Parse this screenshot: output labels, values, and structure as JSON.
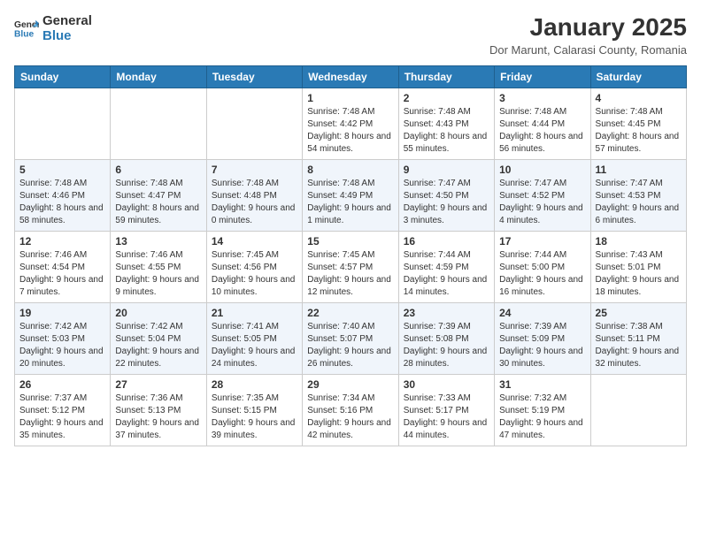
{
  "logo": {
    "general": "General",
    "blue": "Blue"
  },
  "header": {
    "title": "January 2025",
    "subtitle": "Dor Marunt, Calarasi County, Romania"
  },
  "weekdays": [
    "Sunday",
    "Monday",
    "Tuesday",
    "Wednesday",
    "Thursday",
    "Friday",
    "Saturday"
  ],
  "weeks": [
    [
      {
        "day": "",
        "sunrise": "",
        "sunset": "",
        "daylight": ""
      },
      {
        "day": "",
        "sunrise": "",
        "sunset": "",
        "daylight": ""
      },
      {
        "day": "",
        "sunrise": "",
        "sunset": "",
        "daylight": ""
      },
      {
        "day": "1",
        "sunrise": "Sunrise: 7:48 AM",
        "sunset": "Sunset: 4:42 PM",
        "daylight": "Daylight: 8 hours and 54 minutes."
      },
      {
        "day": "2",
        "sunrise": "Sunrise: 7:48 AM",
        "sunset": "Sunset: 4:43 PM",
        "daylight": "Daylight: 8 hours and 55 minutes."
      },
      {
        "day": "3",
        "sunrise": "Sunrise: 7:48 AM",
        "sunset": "Sunset: 4:44 PM",
        "daylight": "Daylight: 8 hours and 56 minutes."
      },
      {
        "day": "4",
        "sunrise": "Sunrise: 7:48 AM",
        "sunset": "Sunset: 4:45 PM",
        "daylight": "Daylight: 8 hours and 57 minutes."
      }
    ],
    [
      {
        "day": "5",
        "sunrise": "Sunrise: 7:48 AM",
        "sunset": "Sunset: 4:46 PM",
        "daylight": "Daylight: 8 hours and 58 minutes."
      },
      {
        "day": "6",
        "sunrise": "Sunrise: 7:48 AM",
        "sunset": "Sunset: 4:47 PM",
        "daylight": "Daylight: 8 hours and 59 minutes."
      },
      {
        "day": "7",
        "sunrise": "Sunrise: 7:48 AM",
        "sunset": "Sunset: 4:48 PM",
        "daylight": "Daylight: 9 hours and 0 minutes."
      },
      {
        "day": "8",
        "sunrise": "Sunrise: 7:48 AM",
        "sunset": "Sunset: 4:49 PM",
        "daylight": "Daylight: 9 hours and 1 minute."
      },
      {
        "day": "9",
        "sunrise": "Sunrise: 7:47 AM",
        "sunset": "Sunset: 4:50 PM",
        "daylight": "Daylight: 9 hours and 3 minutes."
      },
      {
        "day": "10",
        "sunrise": "Sunrise: 7:47 AM",
        "sunset": "Sunset: 4:52 PM",
        "daylight": "Daylight: 9 hours and 4 minutes."
      },
      {
        "day": "11",
        "sunrise": "Sunrise: 7:47 AM",
        "sunset": "Sunset: 4:53 PM",
        "daylight": "Daylight: 9 hours and 6 minutes."
      }
    ],
    [
      {
        "day": "12",
        "sunrise": "Sunrise: 7:46 AM",
        "sunset": "Sunset: 4:54 PM",
        "daylight": "Daylight: 9 hours and 7 minutes."
      },
      {
        "day": "13",
        "sunrise": "Sunrise: 7:46 AM",
        "sunset": "Sunset: 4:55 PM",
        "daylight": "Daylight: 9 hours and 9 minutes."
      },
      {
        "day": "14",
        "sunrise": "Sunrise: 7:45 AM",
        "sunset": "Sunset: 4:56 PM",
        "daylight": "Daylight: 9 hours and 10 minutes."
      },
      {
        "day": "15",
        "sunrise": "Sunrise: 7:45 AM",
        "sunset": "Sunset: 4:57 PM",
        "daylight": "Daylight: 9 hours and 12 minutes."
      },
      {
        "day": "16",
        "sunrise": "Sunrise: 7:44 AM",
        "sunset": "Sunset: 4:59 PM",
        "daylight": "Daylight: 9 hours and 14 minutes."
      },
      {
        "day": "17",
        "sunrise": "Sunrise: 7:44 AM",
        "sunset": "Sunset: 5:00 PM",
        "daylight": "Daylight: 9 hours and 16 minutes."
      },
      {
        "day": "18",
        "sunrise": "Sunrise: 7:43 AM",
        "sunset": "Sunset: 5:01 PM",
        "daylight": "Daylight: 9 hours and 18 minutes."
      }
    ],
    [
      {
        "day": "19",
        "sunrise": "Sunrise: 7:42 AM",
        "sunset": "Sunset: 5:03 PM",
        "daylight": "Daylight: 9 hours and 20 minutes."
      },
      {
        "day": "20",
        "sunrise": "Sunrise: 7:42 AM",
        "sunset": "Sunset: 5:04 PM",
        "daylight": "Daylight: 9 hours and 22 minutes."
      },
      {
        "day": "21",
        "sunrise": "Sunrise: 7:41 AM",
        "sunset": "Sunset: 5:05 PM",
        "daylight": "Daylight: 9 hours and 24 minutes."
      },
      {
        "day": "22",
        "sunrise": "Sunrise: 7:40 AM",
        "sunset": "Sunset: 5:07 PM",
        "daylight": "Daylight: 9 hours and 26 minutes."
      },
      {
        "day": "23",
        "sunrise": "Sunrise: 7:39 AM",
        "sunset": "Sunset: 5:08 PM",
        "daylight": "Daylight: 9 hours and 28 minutes."
      },
      {
        "day": "24",
        "sunrise": "Sunrise: 7:39 AM",
        "sunset": "Sunset: 5:09 PM",
        "daylight": "Daylight: 9 hours and 30 minutes."
      },
      {
        "day": "25",
        "sunrise": "Sunrise: 7:38 AM",
        "sunset": "Sunset: 5:11 PM",
        "daylight": "Daylight: 9 hours and 32 minutes."
      }
    ],
    [
      {
        "day": "26",
        "sunrise": "Sunrise: 7:37 AM",
        "sunset": "Sunset: 5:12 PM",
        "daylight": "Daylight: 9 hours and 35 minutes."
      },
      {
        "day": "27",
        "sunrise": "Sunrise: 7:36 AM",
        "sunset": "Sunset: 5:13 PM",
        "daylight": "Daylight: 9 hours and 37 minutes."
      },
      {
        "day": "28",
        "sunrise": "Sunrise: 7:35 AM",
        "sunset": "Sunset: 5:15 PM",
        "daylight": "Daylight: 9 hours and 39 minutes."
      },
      {
        "day": "29",
        "sunrise": "Sunrise: 7:34 AM",
        "sunset": "Sunset: 5:16 PM",
        "daylight": "Daylight: 9 hours and 42 minutes."
      },
      {
        "day": "30",
        "sunrise": "Sunrise: 7:33 AM",
        "sunset": "Sunset: 5:17 PM",
        "daylight": "Daylight: 9 hours and 44 minutes."
      },
      {
        "day": "31",
        "sunrise": "Sunrise: 7:32 AM",
        "sunset": "Sunset: 5:19 PM",
        "daylight": "Daylight: 9 hours and 47 minutes."
      },
      {
        "day": "",
        "sunrise": "",
        "sunset": "",
        "daylight": ""
      }
    ]
  ]
}
